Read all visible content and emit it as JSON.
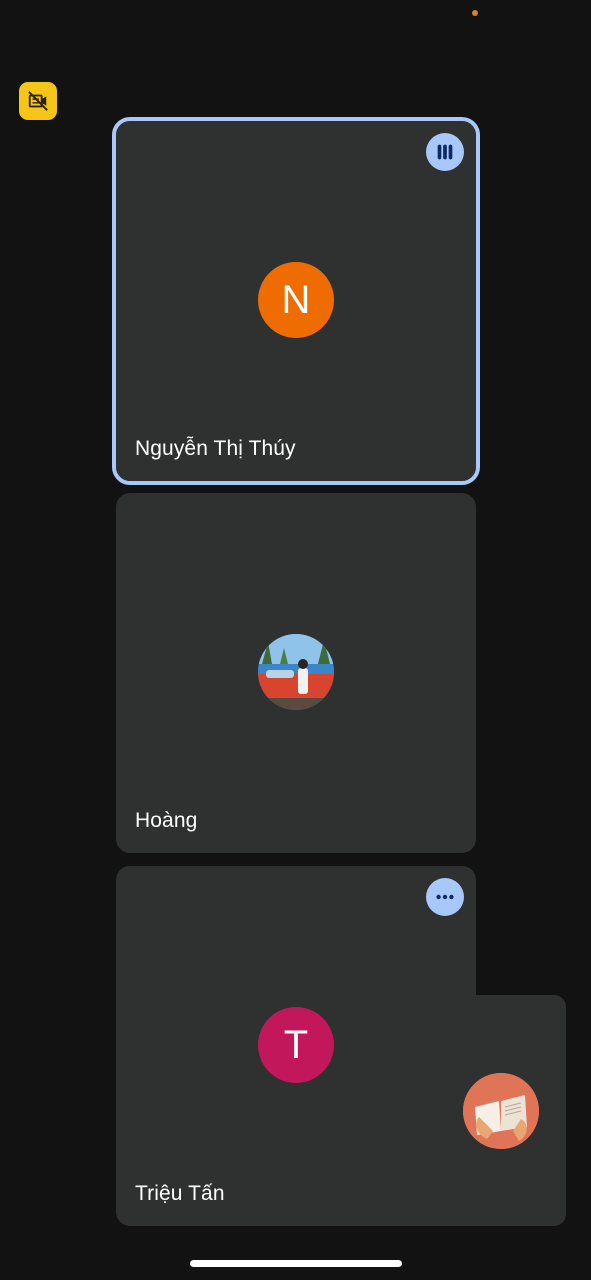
{
  "participants": [
    {
      "name": "Nguyễn Thị Thúy",
      "initial": "N",
      "avatar_color": "#ef6c00",
      "speaking": true,
      "badge_icon": "audio-level-icon"
    },
    {
      "name": "Hoàng",
      "initial": "",
      "avatar_color": "#2a72b5",
      "speaking": false,
      "badge_icon": ""
    },
    {
      "name": "Triệu Tấn",
      "initial": "T",
      "avatar_color": "#c2185b",
      "speaking": false,
      "badge_icon": "more-options-icon"
    }
  ],
  "self": {
    "avatar_icon": "book-photo-avatar"
  },
  "controls": {
    "camera_off_icon": "camera-off-icon"
  },
  "colors": {
    "background": "#121212",
    "tile": "#2f3030",
    "accent": "#a8c7fa",
    "camera_badge": "#f5c518"
  }
}
